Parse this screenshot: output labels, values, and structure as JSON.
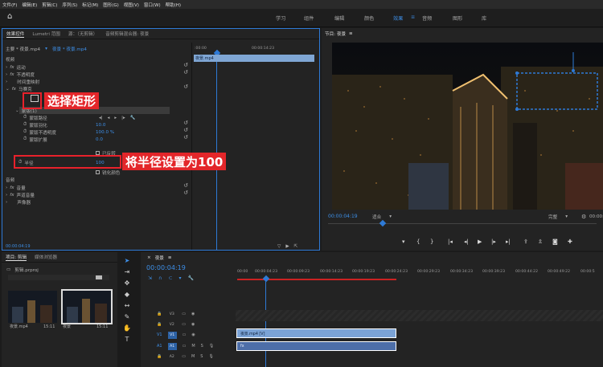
{
  "menubar": [
    "文件(F)",
    "编辑(E)",
    "剪辑(C)",
    "序列(S)",
    "标记(M)",
    "图形(G)",
    "视图(V)",
    "窗口(W)",
    "帮助(H)"
  ],
  "workspace": {
    "tabs": [
      "学习",
      "组件",
      "编辑",
      "颜色",
      "效果",
      "音频",
      "图形",
      "库"
    ],
    "active": "效果"
  },
  "effect_controls": {
    "tabs": [
      "效果控件",
      "Lumetri 范围",
      "源：（无剪辑）",
      "音频剪辑混合器: 夜景"
    ],
    "master": "主要 * 夜景.mp4",
    "clip": "夜景 * 夜景.mp4",
    "timecode_start": ":00:00",
    "timecode_mid": "00:00:14:23",
    "clip_bar_label": "夜景.mp4",
    "sections": {
      "video": "视频",
      "motion": "运动",
      "opacity": "不透明度",
      "time_remap": "时间重映射",
      "mosaic": "马赛克",
      "mask": "蒙版(1)",
      "mask_path": "蒙版路径",
      "mask_feather": "蒙版羽化",
      "mask_opacity": "蒙版不透明度",
      "mask_expansion": "蒙版扩展",
      "inverted": "已反转",
      "radius": "半径",
      "sharp_colors": "锐化颜色",
      "audio": "音频",
      "volume": "音量",
      "channel_volume": "声道音量",
      "panner": "声像器"
    },
    "values": {
      "mask_feather": "10.0",
      "mask_opacity": "100.0 %",
      "mask_expansion": "0.0",
      "radius": "100"
    },
    "timecode_bottom": "00:00:04:19"
  },
  "program": {
    "title": "节目: 夜景",
    "timecode": "00:00:04:19",
    "fit": "适合",
    "quality": "完整",
    "duration": "00:00:14:23"
  },
  "project": {
    "tabs": [
      "项目: 剪辑",
      "媒体浏览器"
    ],
    "file": "剪辑.prproj",
    "items": [
      {
        "name": "夜景.mp4",
        "duration": "15:11"
      },
      {
        "name": "夜景",
        "duration": "15:11"
      }
    ]
  },
  "timeline": {
    "tab": "夜景",
    "timecode": "00:00:04:19",
    "ruler": [
      "00:00",
      "00:00:04:23",
      "00:00:09:23",
      "00:00:14:23",
      "00:00:19:23",
      "00:00:24:23",
      "00:00:29:23",
      "00:00:34:23",
      "00:00:39:23",
      "00:00:44:22",
      "00:00:49:22",
      "00:00:5"
    ],
    "tracks": [
      {
        "id": "V3",
        "type": "video"
      },
      {
        "id": "V2",
        "type": "video"
      },
      {
        "id": "V1",
        "type": "video"
      },
      {
        "id": "A1",
        "type": "audio"
      },
      {
        "id": "A2",
        "type": "audio"
      }
    ],
    "video_clip": "夜景.mp4 [V]",
    "audio_clip_label": "fx"
  },
  "annotations": {
    "select_rect": "选择矩形",
    "set_radius": "将半径设置为100"
  },
  "colors": {
    "accent": "#2e7ad6",
    "annotation_red": "#e3262a"
  }
}
